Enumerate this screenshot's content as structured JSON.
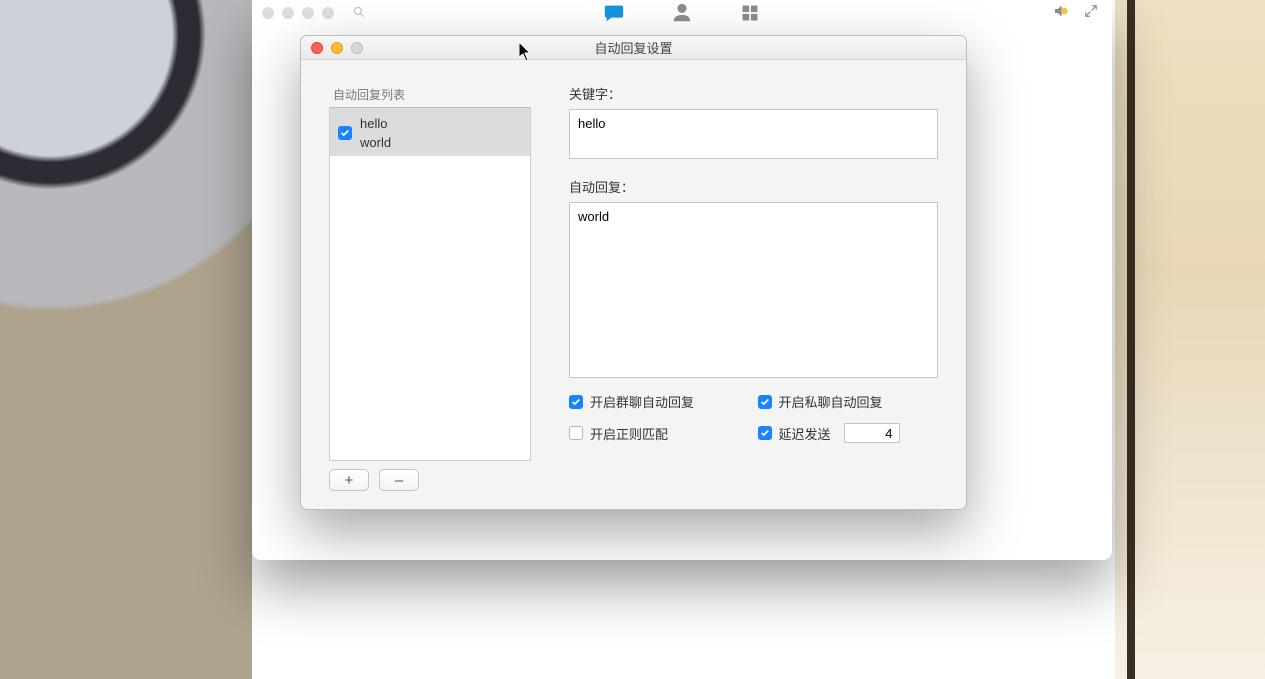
{
  "modal": {
    "title": "自动回复设置",
    "list_header": "自动回复列表",
    "items": [
      {
        "checked": true,
        "keyword": "hello",
        "reply": "world",
        "selected": true
      }
    ],
    "add_label": "+",
    "remove_label": "–"
  },
  "form": {
    "keyword_label": "关键字：",
    "keyword_value": "hello",
    "reply_label": "自动回复：",
    "reply_value": "world",
    "options": {
      "group_chat": {
        "label": "开启群聊自动回复",
        "checked": true
      },
      "private_chat": {
        "label": "开启私聊自动回复",
        "checked": true
      },
      "regex": {
        "label": "开启正则匹配",
        "checked": false
      },
      "delay": {
        "label": "延迟发送",
        "checked": true,
        "value": "4"
      }
    }
  },
  "icons": {
    "chat": "chat-bubble-icon",
    "person": "person-icon",
    "grid": "grid-icon",
    "search": "search-icon",
    "speaker": "speaker-icon",
    "expand": "expand-icon"
  }
}
